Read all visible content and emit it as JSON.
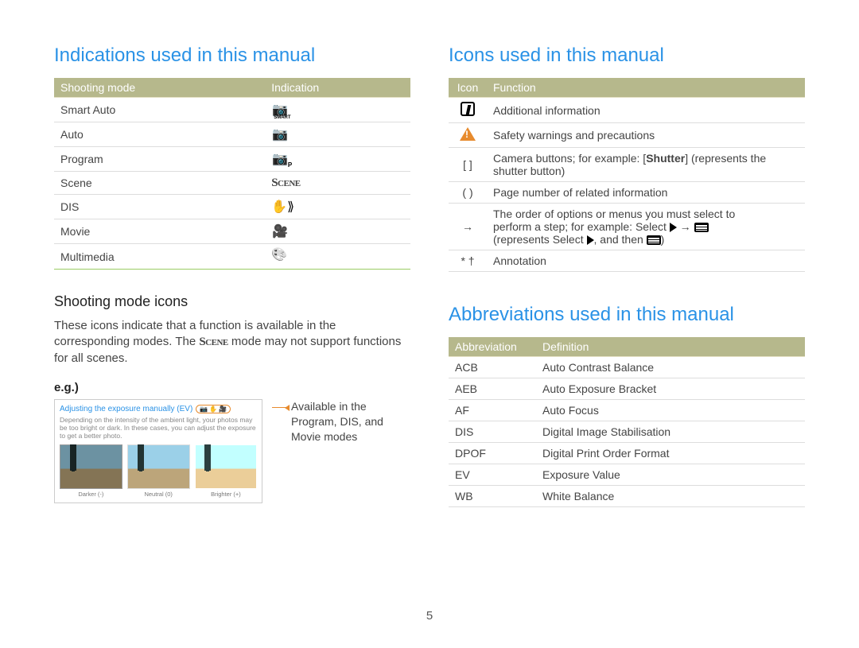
{
  "page_number": "5",
  "left": {
    "heading": "Indications used in this manual",
    "table": {
      "headers": [
        "Shooting mode",
        "Indication"
      ],
      "rows": [
        {
          "mode": "Smart Auto",
          "icon": "smart-auto-icon"
        },
        {
          "mode": "Auto",
          "icon": "auto-icon"
        },
        {
          "mode": "Program",
          "icon": "program-icon"
        },
        {
          "mode": "Scene",
          "icon": "scene-icon"
        },
        {
          "mode": "DIS",
          "icon": "dis-icon"
        },
        {
          "mode": "Movie",
          "icon": "movie-icon"
        },
        {
          "mode": "Multimedia",
          "icon": "multimedia-icon"
        }
      ]
    },
    "sub_heading": "Shooting mode icons",
    "paragraph_parts": {
      "p1": "These icons indicate that a function is available in the corresponding modes. The ",
      "scene_word": "Scene",
      "p2": " mode may not support functions for all scenes."
    },
    "eg_label": "e.g.)",
    "screenshot": {
      "title": "Adjusting the exposure manually (EV)",
      "badge_icons": [
        "program-mini-icon",
        "dis-mini-icon",
        "movie-mini-icon"
      ],
      "body": "Depending on the intensity of the ambient light, your photos may be too bright or dark. In these cases, you can adjust the exposure to get a better photo.",
      "thumbs": [
        "Darker (-)",
        "Neutral (0)",
        "Brighter (+)"
      ]
    },
    "caption": "Available in the Program, DIS, and Movie modes"
  },
  "right": {
    "icons_heading": "Icons used in this manual",
    "icons_table": {
      "headers": [
        "Icon",
        "Function"
      ],
      "rows": [
        {
          "glyph": "info",
          "text": "Additional information"
        },
        {
          "glyph": "warn",
          "text": "Safety warnings and precautions"
        },
        {
          "glyph": "[ ]",
          "text_pre": "Camera buttons; for example: [",
          "bold": "Shutter",
          "text_post": "] (represents the shutter button)"
        },
        {
          "glyph": "( )",
          "text": "Page number of related information"
        },
        {
          "glyph": "→",
          "seq": true,
          "line1": "The order of options or menus you must select to",
          "line2a": "perform a step; for example: Select ",
          "line2b": " → ",
          "line3a": "(represents Select ",
          "line3b": ", and then ",
          "line3c": ")"
        },
        {
          "glyph": "* †",
          "text": "Annotation"
        }
      ]
    },
    "abbr_heading": "Abbreviations used in this manual",
    "abbr_table": {
      "headers": [
        "Abbreviation",
        "Definition"
      ],
      "rows": [
        {
          "abbr": "ACB",
          "def": "Auto Contrast Balance"
        },
        {
          "abbr": "AEB",
          "def": "Auto Exposure Bracket"
        },
        {
          "abbr": "AF",
          "def": "Auto Focus"
        },
        {
          "abbr": "DIS",
          "def": "Digital Image Stabilisation"
        },
        {
          "abbr": "DPOF",
          "def": "Digital Print Order Format"
        },
        {
          "abbr": "EV",
          "def": "Exposure Value"
        },
        {
          "abbr": "WB",
          "def": "White Balance"
        }
      ]
    }
  }
}
